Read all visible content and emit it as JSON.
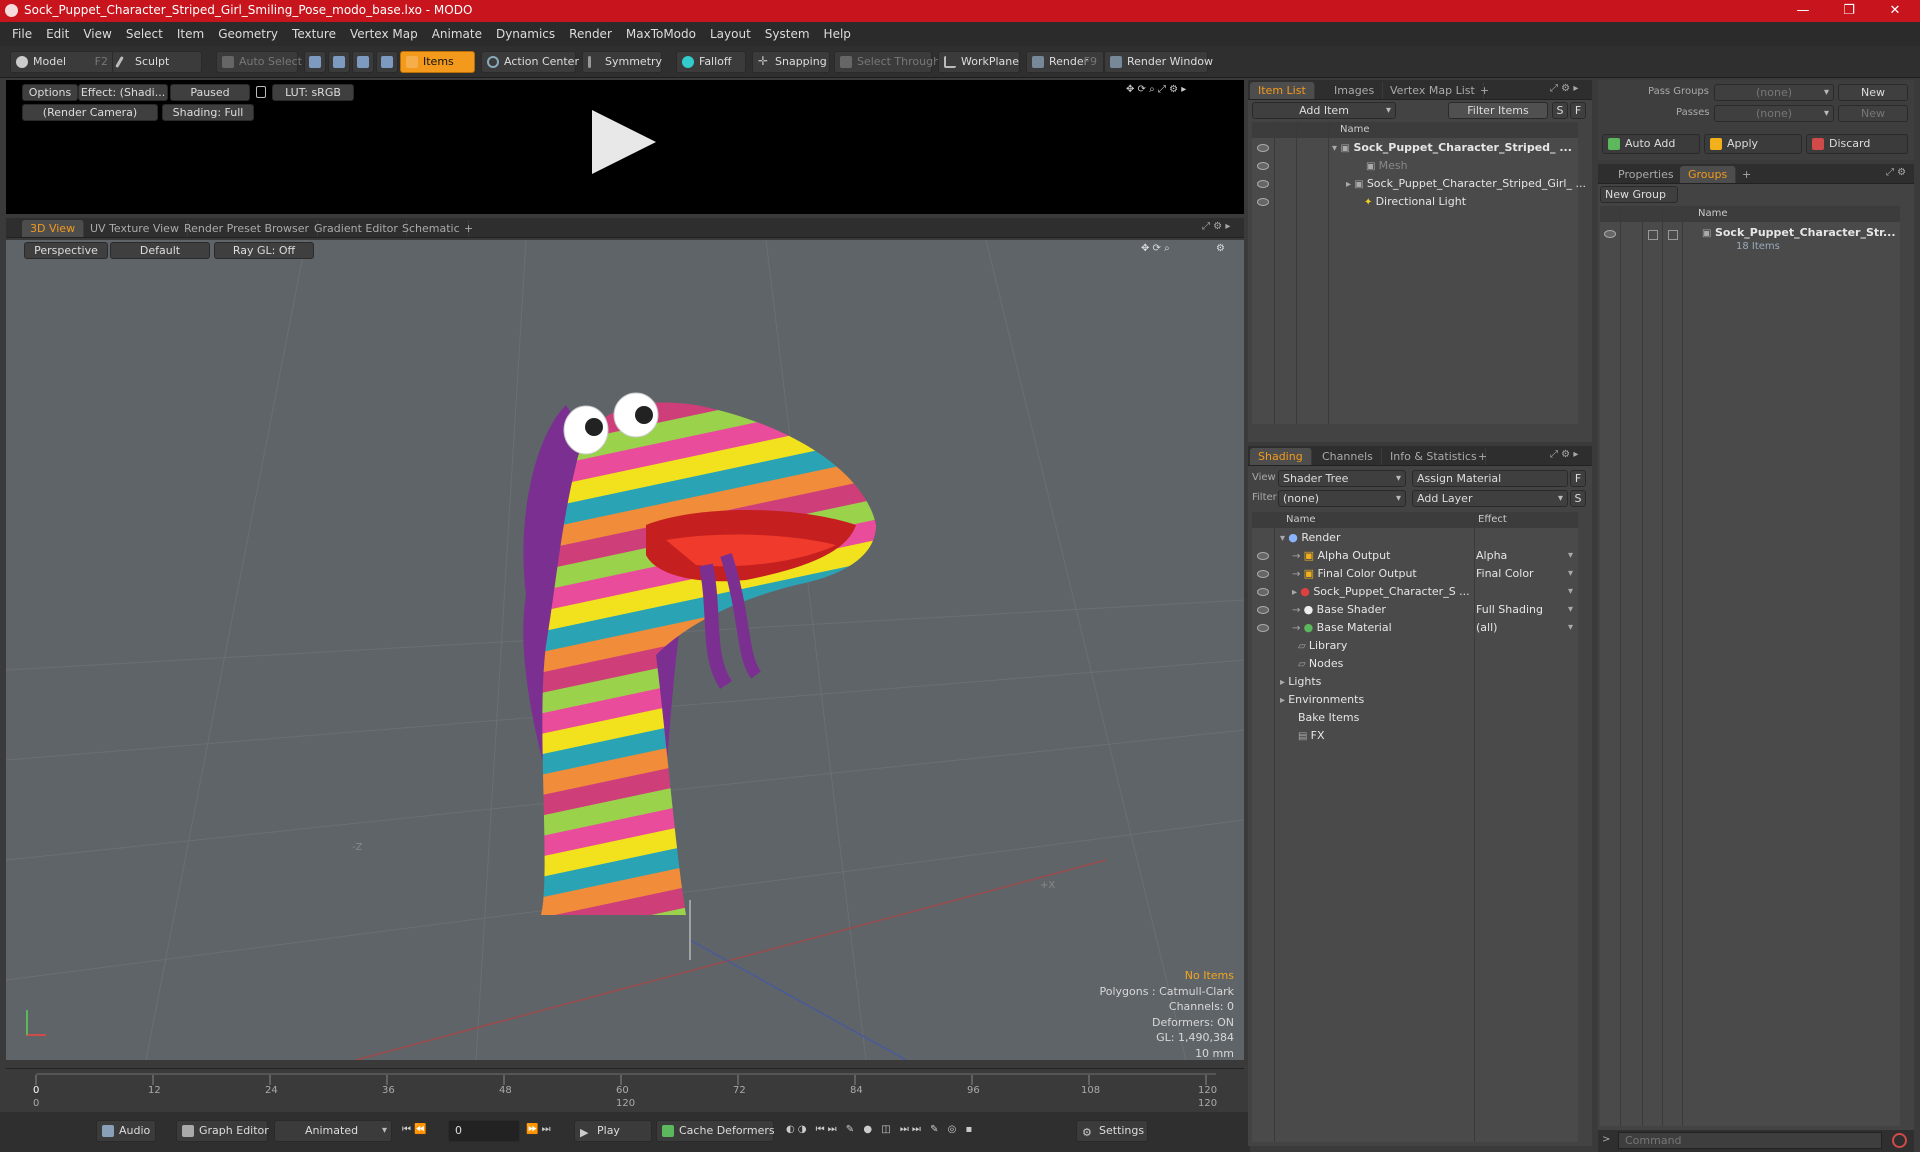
{
  "app": {
    "title": "Sock_Puppet_Character_Striped_Girl_Smiling_Pose_modo_base.lxo - MODO",
    "min": "—",
    "max": "❐",
    "close": "✕"
  },
  "menu": [
    "File",
    "Edit",
    "View",
    "Select",
    "Item",
    "Geometry",
    "Texture",
    "Vertex Map",
    "Animate",
    "Dynamics",
    "Render",
    "MaxToModo",
    "Layout",
    "System",
    "Help"
  ],
  "toolbar": {
    "model": "Model",
    "model_key": "F2",
    "sculpt": "Sculpt",
    "auto_select": "Auto Select",
    "items": "Items",
    "action_center": "Action Center",
    "symmetry": "Symmetry",
    "falloff": "Falloff",
    "snapping": "Snapping",
    "select_through": "Select Through",
    "workplane": "WorkPlane",
    "render": "Render",
    "render_key": "F9",
    "render_window": "Render Window"
  },
  "preview": {
    "options": "Options",
    "effect": "Effect: (Shadi...",
    "paused": "Paused",
    "lut": "LUT: sRGB",
    "camera": "(Render Camera)",
    "shading": "Shading: Full"
  },
  "viewtabs": [
    "3D View",
    "UV Texture View",
    "Render Preset Browser",
    "Gradient Editor",
    "Schematic"
  ],
  "viewport": {
    "perspective": "Perspective",
    "default": "Default",
    "raygl": "Ray GL: Off",
    "axis_z": "-Z",
    "axis_x": "+X",
    "stats": {
      "no_items": "No Items",
      "polygons": "Polygons : Catmull-Clark",
      "channels": "Channels: 0",
      "deformers": "Deformers: ON",
      "gl": "GL: 1,490,384",
      "scale": "10 mm"
    }
  },
  "timeline": {
    "ticks": [
      "0",
      "12",
      "24",
      "36",
      "48",
      "60",
      "72",
      "84",
      "96",
      "108",
      "120"
    ],
    "sub_left": "0",
    "sub_mid": "120",
    "sub_right": "120"
  },
  "bottombar": {
    "audio": "Audio",
    "graph": "Graph Editor",
    "animated": "Animated",
    "frame": "0",
    "play": "Play",
    "cache": "Cache Deformers",
    "settings": "Settings"
  },
  "itemlist": {
    "tabs": [
      "Item List",
      "Images",
      "Vertex Map List"
    ],
    "add_item": "Add Item",
    "filter": "Filter Items",
    "s": "S",
    "f": "F",
    "col_name": "Name",
    "rows": [
      "Sock_Puppet_Character_Striped_ ...",
      "Mesh",
      "Sock_Puppet_Character_Striped_Girl_ ...",
      "Directional Light"
    ]
  },
  "shading": {
    "tabs": [
      "Shading",
      "Channels",
      "Info & Statistics"
    ],
    "view_label": "View",
    "view_val": "Shader Tree",
    "assign": "Assign Material",
    "f": "F",
    "filter_label": "Filter",
    "filter_val": "(none)",
    "add_layer": "Add Layer",
    "s": "S",
    "col_name": "Name",
    "col_effect": "Effect",
    "rows": [
      {
        "name": "Render",
        "effect": ""
      },
      {
        "name": "Alpha Output",
        "effect": "Alpha"
      },
      {
        "name": "Final Color Output",
        "effect": "Final Color"
      },
      {
        "name": "Sock_Puppet_Character_S ...",
        "effect": ""
      },
      {
        "name": "Base Shader",
        "effect": "Full Shading"
      },
      {
        "name": "Base Material",
        "effect": "(all)"
      },
      {
        "name": "Library",
        "effect": ""
      },
      {
        "name": "Nodes",
        "effect": ""
      },
      {
        "name": "Lights",
        "effect": ""
      },
      {
        "name": "Environments",
        "effect": ""
      },
      {
        "name": "Bake Items",
        "effect": ""
      },
      {
        "name": "FX",
        "effect": ""
      }
    ]
  },
  "passes": {
    "pass_groups": "Pass Groups",
    "passes": "Passes",
    "none": "(none)",
    "new": "New",
    "auto_add": "Auto Add",
    "apply": "Apply",
    "discard": "Discard"
  },
  "groups": {
    "tabs": [
      "Properties",
      "Groups"
    ],
    "new_group": "New Group",
    "col_name": "Name",
    "group_name": "Sock_Puppet_Character_Str...",
    "group_count": "18 Items"
  },
  "command": {
    "placeholder": "Command"
  }
}
